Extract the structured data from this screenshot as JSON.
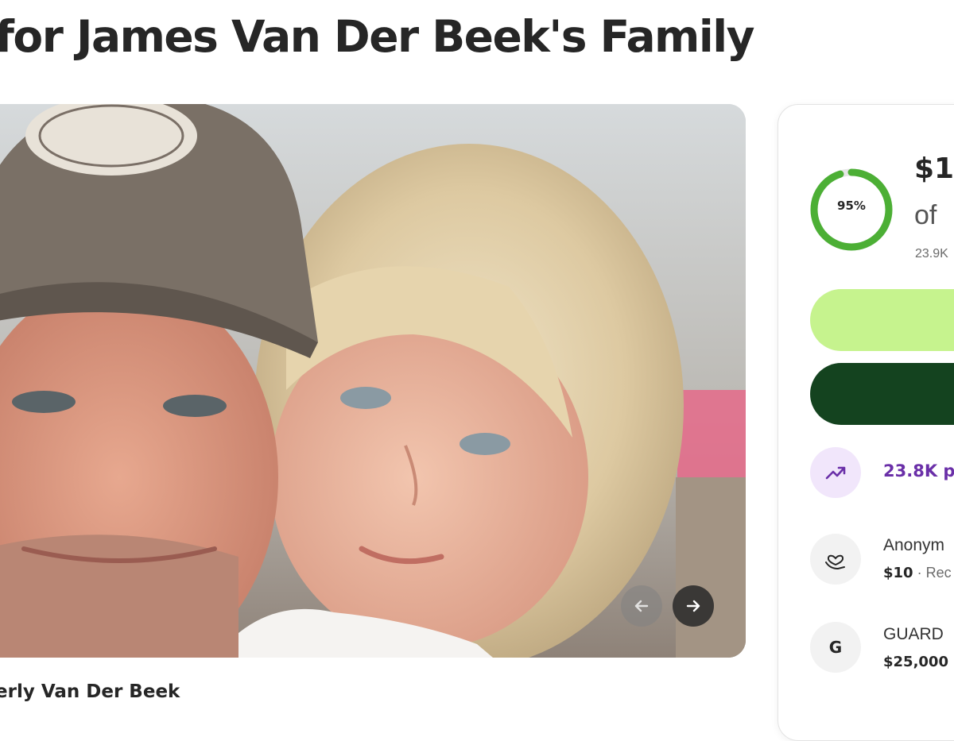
{
  "page": {
    "title": "for James Van Der Beek's Family",
    "organizer": "erly Van Der Beek"
  },
  "gallery": {
    "photo_icon": "family-selfie-photo",
    "prev_icon": "arrow-left-icon",
    "next_icon": "arrow-right-icon"
  },
  "fundraiser": {
    "progress_percent": 95,
    "progress_label": "95%",
    "raised_text": "$1,",
    "goal_text": "of",
    "donations_text": "23.9K",
    "share_label": "",
    "donate_label": "",
    "trend_text": "23.8K p"
  },
  "donations": [
    {
      "name": "Anonym",
      "amount": "$10",
      "suffix": " · Rec",
      "icon": "heart-hand-icon"
    },
    {
      "name": "GUARD",
      "amount": "$25,000",
      "suffix": "",
      "icon": "letter-avatar",
      "initial": "G"
    }
  ],
  "colors": {
    "progress_green": "#4caf35",
    "share_button": "#c6f38e",
    "donate_button": "#14431f",
    "trend_purple": "#6a2fa8"
  }
}
